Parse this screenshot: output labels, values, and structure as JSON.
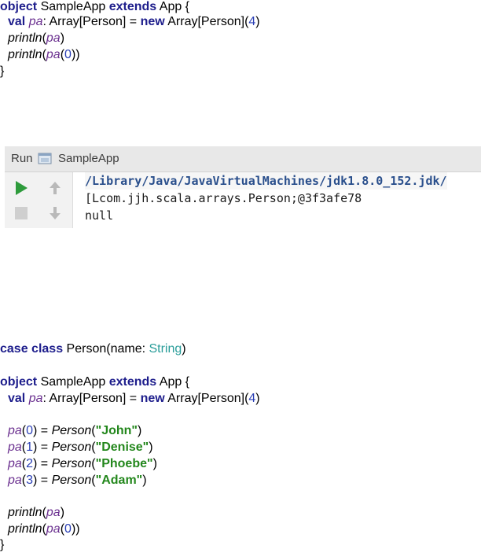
{
  "snippet1": {
    "kw_object": "object",
    "obj_name": " SampleApp ",
    "kw_extends": "extends",
    "obj_parent": " App {",
    "val_kw": "val",
    "val_name": "pa",
    "val_type": ": Array[Person] = ",
    "new_kw": "new",
    "new_type": " Array[Person](",
    "array_size": "4",
    "close_paren": ")",
    "println": "println",
    "open_paren": "(",
    "pa": "pa",
    "index0": "0",
    "close_paren2": "))",
    "close_brace": "}"
  },
  "run_panel": {
    "tab_label": "Run",
    "config_name": "SampleApp",
    "console": [
      "/Library/Java/JavaVirtualMachines/jdk1.8.0_152.jdk/",
      "[Lcom.jjh.scala.arrays.Person;@3f3afe78",
      "null"
    ]
  },
  "snippet2": {
    "kw_case": "case",
    "kw_class": "class",
    "class_name": " Person(name: ",
    "string_type": "String",
    "class_close": ")",
    "kw_object": "object",
    "obj_name": " SampleApp ",
    "kw_extends": "extends",
    "obj_parent": " App {",
    "val_kw": "val",
    "val_name": "pa",
    "val_type": ": Array[Person] = ",
    "new_kw": "new",
    "new_type": " Array[Person](",
    "array_size": "4",
    "close_paren": ")",
    "pa": "pa",
    "assign": ") = ",
    "person_fn": "Person",
    "open_paren": "(",
    "assignments": [
      {
        "index": "0",
        "value": "\"John\""
      },
      {
        "index": "1",
        "value": "\"Denise\""
      },
      {
        "index": "2",
        "value": "\"Phoebe\""
      },
      {
        "index": "3",
        "value": "\"Adam\""
      }
    ],
    "println": "println",
    "index0": "0",
    "close_paren2": "))",
    "close_brace": "}"
  },
  "colors": {
    "keyword": "#1e1e8c",
    "variable": "#6a2f8f",
    "number": "#2a3fb5",
    "string": "#23871c",
    "type_literal": "#2a9d9a",
    "run_green": "#2e9b3c"
  },
  "icons": {
    "run": "play-icon",
    "stop": "stop-icon",
    "up": "arrow-up-icon",
    "down": "arrow-down-icon",
    "config": "app-window-icon"
  }
}
